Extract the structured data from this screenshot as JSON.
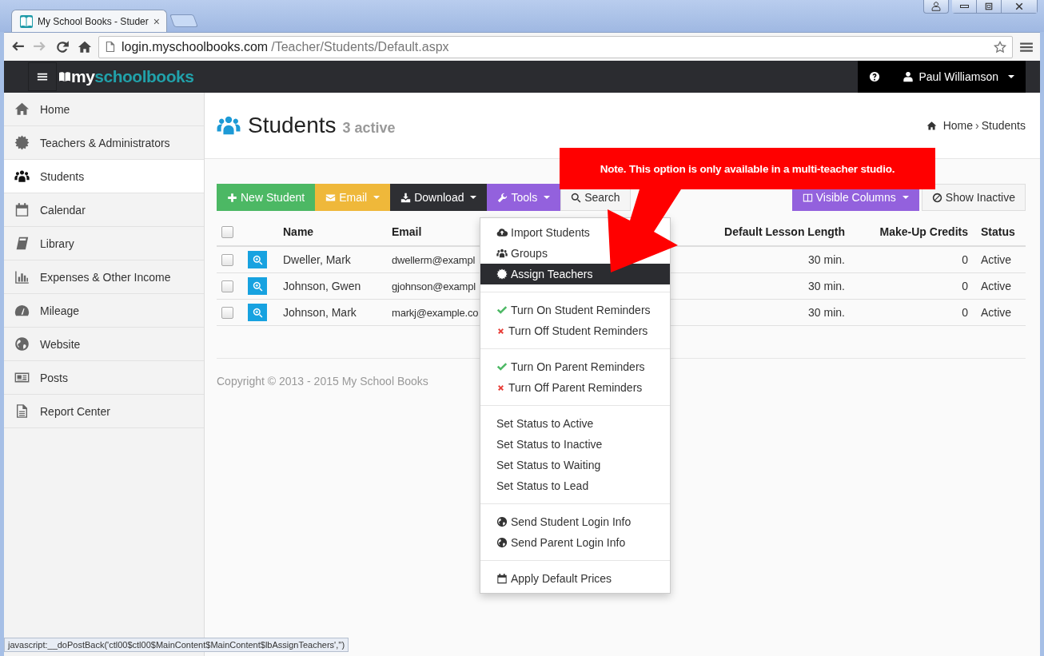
{
  "browser": {
    "tab_title": "My School Books - Studer",
    "tab_close": "×",
    "url_host": "login.myschoolbooks.com",
    "url_path": "/Teacher/Students/Default.aspx"
  },
  "navbar": {
    "brand_prefix": "my",
    "brand_suffix": "schoolbooks",
    "user": "Paul Williamson"
  },
  "sidebar": {
    "items": [
      {
        "label": "Home",
        "selected": false
      },
      {
        "label": "Teachers & Administrators",
        "selected": false
      },
      {
        "label": "Students",
        "selected": true
      },
      {
        "label": "Calendar",
        "selected": false
      },
      {
        "label": "Library",
        "selected": false
      },
      {
        "label": "Expenses & Other Income",
        "selected": false
      },
      {
        "label": "Mileage",
        "selected": false
      },
      {
        "label": "Website",
        "selected": false
      },
      {
        "label": "Posts",
        "selected": false
      },
      {
        "label": "Report Center",
        "selected": false
      }
    ]
  },
  "header": {
    "title": "Students",
    "subtitle": "3 active",
    "breadcrumb": [
      "Home",
      "Students"
    ],
    "separator": "›"
  },
  "toolbar": {
    "left": [
      {
        "label": "New Student",
        "color": "#4cb864",
        "dropdown": false
      },
      {
        "label": "Email",
        "color": "#efb83a",
        "dropdown": true
      },
      {
        "label": "Download",
        "color": "#2e2f33",
        "dropdown": true
      },
      {
        "label": "Tools",
        "color": "#9361dd",
        "dropdown": true
      },
      {
        "label": "Search",
        "color": "#f5f5f5",
        "dropdown": false
      }
    ],
    "right": [
      {
        "label": "Visible Columns",
        "color": "#9361dd",
        "dropdown": true
      },
      {
        "label": "Show Inactive",
        "color": "#f5f5f5",
        "dropdown": false
      }
    ]
  },
  "table": {
    "columns": [
      "Name",
      "Email",
      "Default Lesson Length",
      "Make-Up Credits",
      "Status"
    ],
    "all_checked": false,
    "rows": [
      {
        "checked": false,
        "name": "Dweller, Mark",
        "email": "dwellerm@exampl",
        "lesson": "30 min.",
        "credits": "0",
        "status": "Active"
      },
      {
        "checked": false,
        "name": "Johnson, Gwen",
        "email": "gjohnson@exampl",
        "lesson": "30 min.",
        "credits": "0",
        "status": "Active"
      },
      {
        "checked": false,
        "name": "Johnson, Mark",
        "email": "markj@example.co",
        "lesson": "30 min.",
        "credits": "0",
        "status": "Active"
      }
    ]
  },
  "footer": "Copyright © 2013 - 2015 My School Books",
  "tools_menu": {
    "sections": [
      [
        {
          "label": "Import Students",
          "kind": "upload",
          "selected": false
        },
        {
          "label": "Groups",
          "kind": "group",
          "selected": false
        },
        {
          "label": "Assign Teachers",
          "kind": "gear",
          "selected": true
        }
      ],
      [
        {
          "label": "Turn On Student Reminders",
          "kind": "on",
          "selected": false
        },
        {
          "label": "Turn Off Student Reminders",
          "kind": "off",
          "selected": false
        }
      ],
      [
        {
          "label": "Turn On Parent Reminders",
          "kind": "on",
          "selected": false
        },
        {
          "label": "Turn Off Parent Reminders",
          "kind": "off",
          "selected": false
        }
      ],
      [
        {
          "label": "Set Status to Active",
          "kind": "plain",
          "selected": false
        },
        {
          "label": "Set Status to Inactive",
          "kind": "plain",
          "selected": false
        },
        {
          "label": "Set Status to Waiting",
          "kind": "plain",
          "selected": false
        },
        {
          "label": "Set Status to Lead",
          "kind": "plain",
          "selected": false
        }
      ],
      [
        {
          "label": "Send Student Login Info",
          "kind": "globe",
          "selected": false
        },
        {
          "label": "Send Parent Login Info",
          "kind": "globe",
          "selected": false
        }
      ],
      [
        {
          "label": "Apply Default Prices",
          "kind": "calendar",
          "selected": false
        }
      ]
    ]
  },
  "callout": "Note. This option is only available in a multi-teacher studio.",
  "status_bar": "javascript:__doPostBack('ctl00$ctl00$MainContent$MainContent$lbAssignTeachers','')"
}
